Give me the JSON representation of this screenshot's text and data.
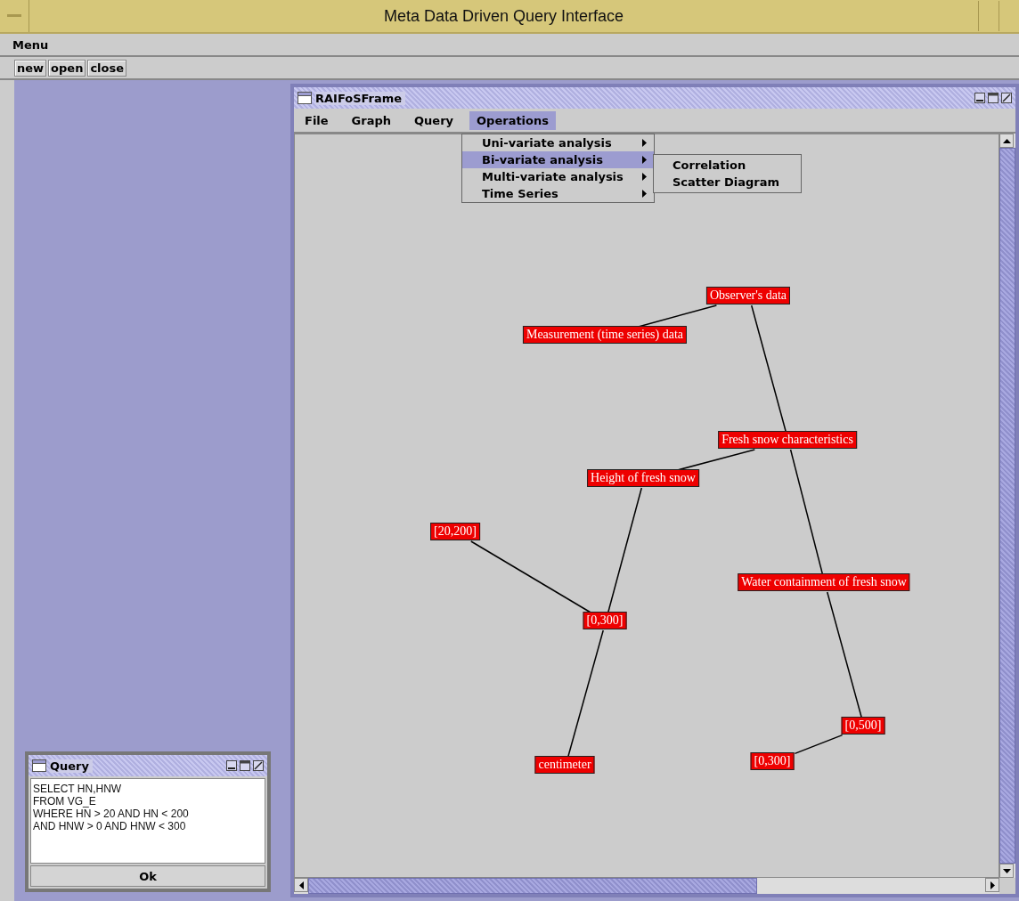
{
  "window": {
    "title": "Meta Data Driven Query Interface"
  },
  "menu_bar": [
    {
      "label": "Menu"
    }
  ],
  "toolbar": [
    {
      "label": "new"
    },
    {
      "label": "open"
    },
    {
      "label": "close"
    }
  ],
  "graph_frame": {
    "title": "RAIFoSFrame",
    "menus": [
      {
        "label": "File",
        "selected": false
      },
      {
        "label": "Graph",
        "selected": false
      },
      {
        "label": "Query",
        "selected": false
      },
      {
        "label": "Operations",
        "selected": true
      }
    ],
    "dropdown": [
      {
        "label": "Uni-variate analysis",
        "selected": false
      },
      {
        "label": "Bi-variate analysis",
        "selected": true
      },
      {
        "label": "Multi-variate analysis",
        "selected": false
      },
      {
        "label": "Time Series",
        "selected": false
      }
    ],
    "submenu": [
      {
        "label": "Correlation"
      },
      {
        "label": "Scatter Diagram"
      }
    ],
    "graph": {
      "label": "Observer's data",
      "children": [
        {
          "label": "Measurement (time series) data"
        },
        {
          "label": "Fresh snow characteristics",
          "children": [
            {
              "label": "Height of fresh snow",
              "children": [
                {
                  "label": "[0,300]",
                  "children": [
                    {
                      "label": "[20,200]"
                    },
                    {
                      "label": "centimeter"
                    }
                  ]
                }
              ]
            },
            {
              "label": "Water containment of fresh snow",
              "children": [
                {
                  "label": "[0,500]",
                  "children": [
                    {
                      "label": "[0,300]"
                    }
                  ]
                }
              ]
            }
          ]
        }
      ]
    }
  },
  "query_frame": {
    "title": "Query",
    "lines": [
      "SELECT HN,HNW",
      "FROM VG_E",
      "WHERE HN > 20 AND HN < 200",
      "AND HNW > 0 AND HNW < 300"
    ],
    "button": "Ok"
  }
}
